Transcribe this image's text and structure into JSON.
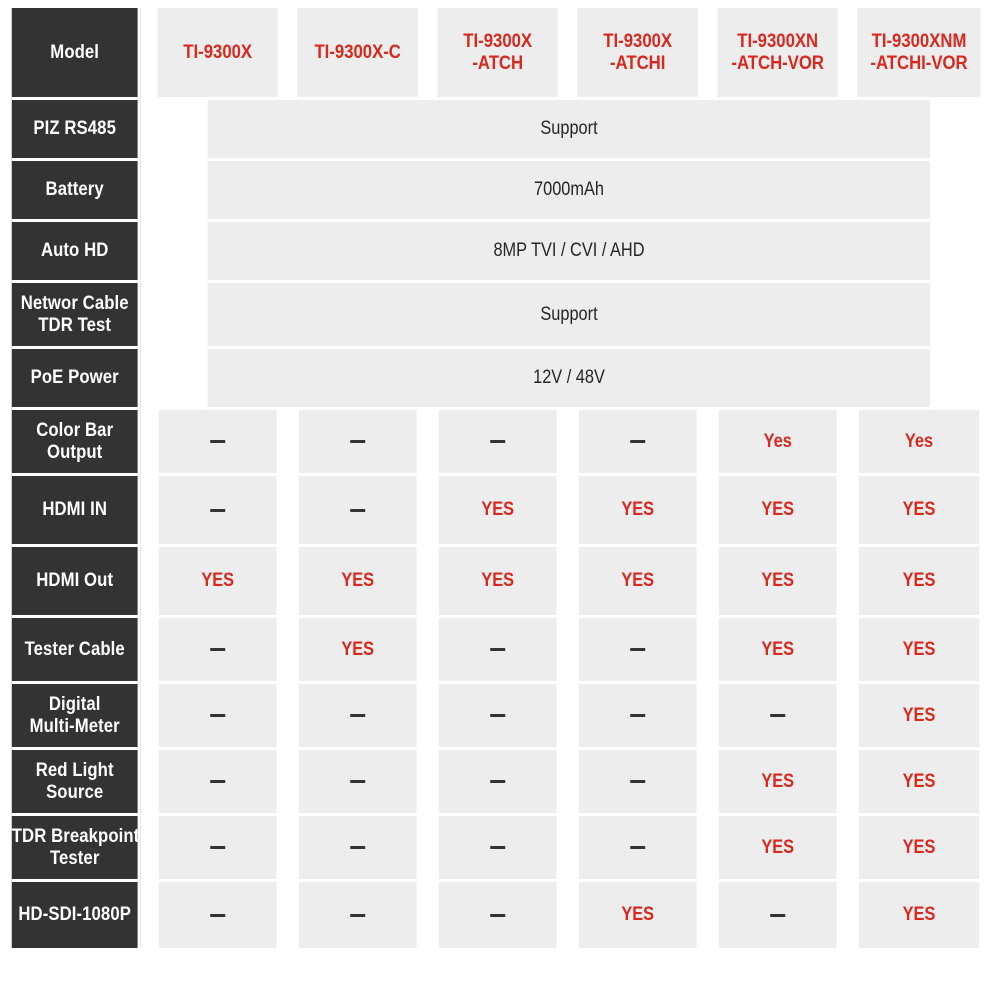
{
  "table": {
    "row_header_label": "Model",
    "columns": [
      {
        "name": "TI-9300X",
        "line1": "TI-9300X",
        "line2": ""
      },
      {
        "name": "TI-9300X-C",
        "line1": "TI-9300X-C",
        "line2": ""
      },
      {
        "name": "TI-9300X-ATCH",
        "line1": "TI-9300X",
        "line2": "-ATCH"
      },
      {
        "name": "TI-9300X-ATCHI",
        "line1": "TI-9300X",
        "line2": "-ATCHI"
      },
      {
        "name": "TI-9300XN-ATCH-VOR",
        "line1": "TI-9300XN",
        "line2": "-ATCH-VOR"
      },
      {
        "name": "TI-9300XNM-ATCHI-VOR",
        "line1": "TI-9300XNM",
        "line2": "-ATCHI-VOR"
      }
    ],
    "rows": [
      {
        "label_line1": "PIZ RS485",
        "label_line2": "",
        "merged": true,
        "merged_value": "Support",
        "size": "std"
      },
      {
        "label_line1": "Battery",
        "label_line2": "",
        "merged": true,
        "merged_value": "7000mAh",
        "size": "std"
      },
      {
        "label_line1": "Auto HD",
        "label_line2": "",
        "merged": true,
        "merged_value": "8MP TVI / CVI / AHD",
        "size": "std"
      },
      {
        "label_line1": "Networ Cable",
        "label_line2": "TDR Test",
        "merged": true,
        "merged_value": "Support",
        "size": "tall"
      },
      {
        "label_line1": "PoE Power",
        "label_line2": "",
        "merged": true,
        "merged_value": "12V / 48V",
        "size": "std"
      },
      {
        "label_line1": "Color Bar",
        "label_line2": "Output",
        "merged": false,
        "size": "tall",
        "values": [
          "—",
          "—",
          "—",
          "—",
          "Yes",
          "Yes"
        ]
      },
      {
        "label_line1": "HDMI IN",
        "label_line2": "",
        "merged": false,
        "size": "xtall",
        "values": [
          "—",
          "—",
          "YES",
          "YES",
          "YES",
          "YES"
        ]
      },
      {
        "label_line1": "HDMI Out",
        "label_line2": "",
        "merged": false,
        "size": "xtall",
        "values": [
          "YES",
          "YES",
          "YES",
          "YES",
          "YES",
          "YES"
        ]
      },
      {
        "label_line1": "Tester Cable",
        "label_line2": "",
        "merged": false,
        "size": "tall",
        "values": [
          "—",
          "YES",
          "—",
          "—",
          "YES",
          "YES"
        ]
      },
      {
        "label_line1": "Digital",
        "label_line2": "Multi-Meter",
        "merged": false,
        "size": "tall",
        "values": [
          "—",
          "—",
          "—",
          "—",
          "—",
          "YES"
        ]
      },
      {
        "label_line1": "Red Light",
        "label_line2": "Source",
        "merged": false,
        "size": "tall",
        "values": [
          "—",
          "—",
          "—",
          "—",
          "YES",
          "YES"
        ]
      },
      {
        "label_line1": "TDR Breakpoint",
        "label_line2": "Tester",
        "merged": false,
        "size": "tall",
        "values": [
          "—",
          "—",
          "—",
          "—",
          "YES",
          "YES"
        ]
      },
      {
        "label_line1": "HD-SDI-1080P",
        "label_line2": "",
        "merged": false,
        "size": "tall",
        "values": [
          "—",
          "—",
          "—",
          "YES",
          "—",
          "YES"
        ]
      }
    ]
  },
  "colors": {
    "label_background": "#333333",
    "label_text": "#ffffff",
    "cell_background": "#ededed",
    "grid_line": "#ffffff",
    "accent_red": "#d9281e",
    "value_text": "#333333"
  }
}
